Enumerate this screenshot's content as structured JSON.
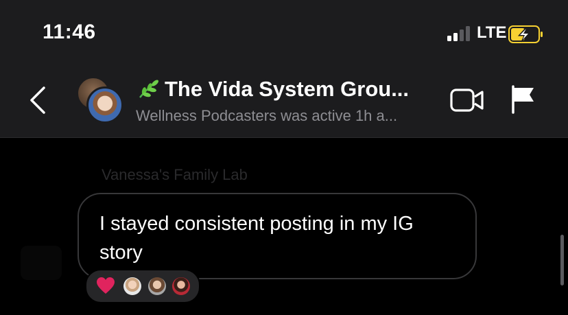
{
  "status": {
    "time": "11:46",
    "network": "LTE"
  },
  "chat": {
    "title": "The Vida System Grou...",
    "subtitle": "Wellness Podcasters was active 1h a..."
  },
  "message": {
    "sender": "Vanessa's Family Lab",
    "text": "I stayed consistent posting in my IG story"
  },
  "icons": {
    "back": "chevron-left-icon",
    "leaf": "herb-emoji",
    "video": "video-camera-icon",
    "flag": "flag-icon",
    "reaction": "red-heart-emoji"
  },
  "colors": {
    "bubble_border": "#38383a",
    "header_bg": "#1c1c1e",
    "battery": "#f7d132",
    "heart": "#e0245e"
  }
}
